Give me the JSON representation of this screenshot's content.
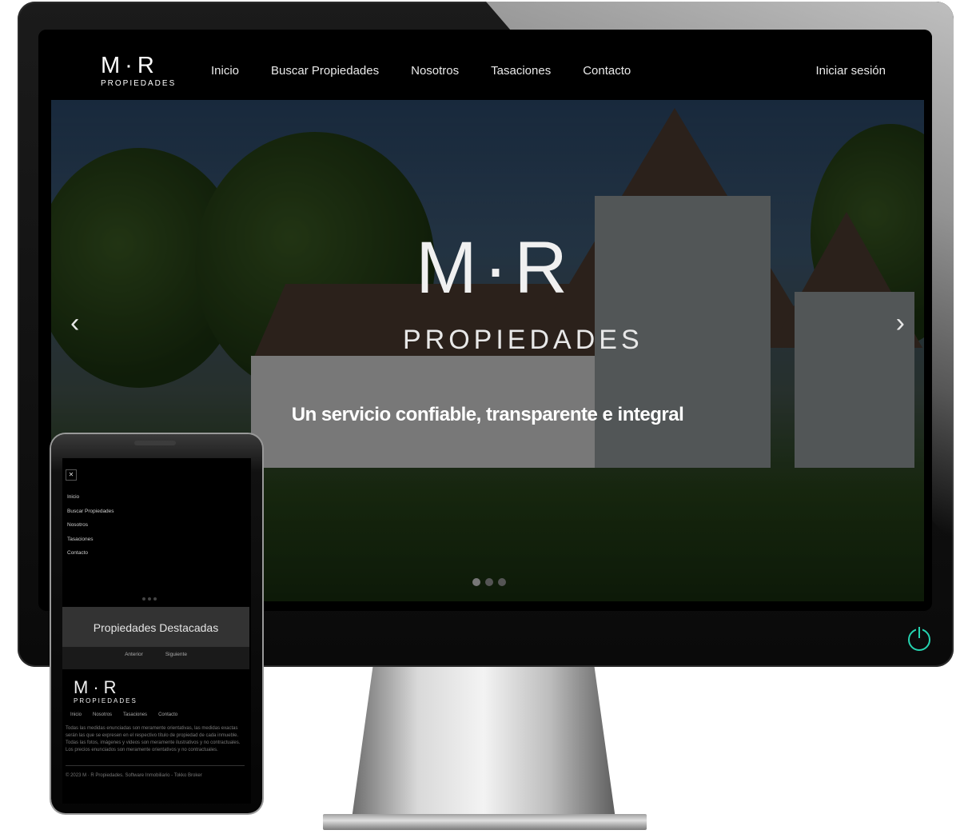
{
  "site": {
    "logo_mr": "M·R",
    "logo_sub": "PROPIEDADES",
    "nav": [
      "Inicio",
      "Buscar Propiedades",
      "Nosotros",
      "Tasaciones",
      "Contacto"
    ],
    "login": "Iniciar sesión"
  },
  "hero": {
    "logo_mr": "M·R",
    "logo_sub": "PROPIEDADES",
    "tagline": "Un servicio confiable, transparente e integral",
    "prev_arrow": "‹",
    "next_arrow": "›",
    "slides_count": 3,
    "active_slide": 0
  },
  "phone": {
    "toggle": "✕",
    "menu": [
      "Inicio",
      "Buscar Propiedades",
      "Nosotros",
      "Tasaciones",
      "Contacto"
    ],
    "featured_title": "Propiedades Destacadas",
    "pager_prev": "Anterior",
    "pager_next": "Siguiente",
    "footer_logo_mr": "M·R",
    "footer_logo_sub": "PROPIEDADES",
    "footer_nav": [
      "Inicio",
      "Nosotros",
      "Tasaciones",
      "Contacto"
    ],
    "disclaimer": "Todas las medidas enunciadas son meramente orientativas, las medidas exactas serán las que se expresen en el respectivo título de propiedad de cada inmueble. Todas las fotos, imágenes y videos son meramente ilustrativos y no contractuales. Los precios enunciados son meramente orientativos y no contractuales.",
    "copyright": "© 2023 M · R Propiedades. Software Inmobiliario - Tokko Broker"
  },
  "colors": {
    "power_accent": "#25d3b0",
    "screen_bg": "#000000"
  }
}
